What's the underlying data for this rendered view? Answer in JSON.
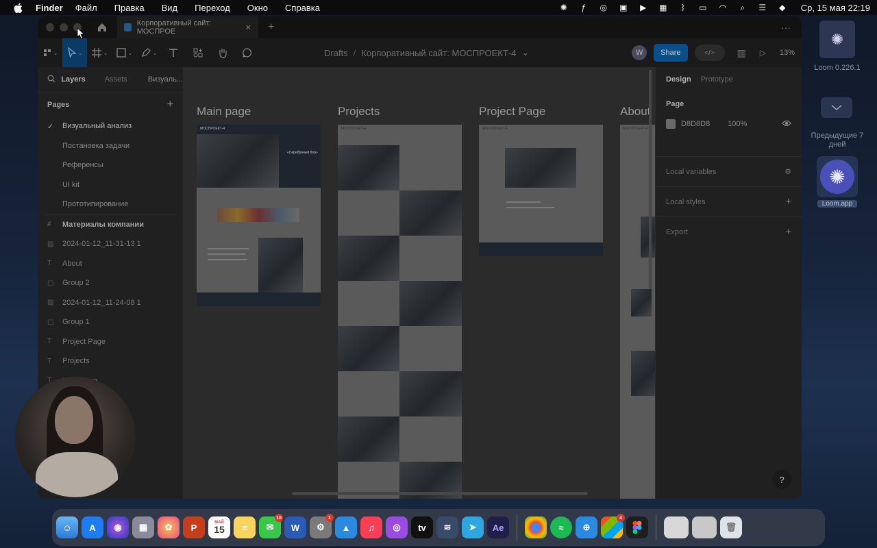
{
  "menubar": {
    "app": "Finder",
    "items": [
      "Файл",
      "Правка",
      "Вид",
      "Переход",
      "Окно",
      "Справка"
    ],
    "clock": "Ср, 15 мая  22:19"
  },
  "tabbar": {
    "tab_title": "Корпоративный сайт: МОСПРОЕ",
    "close": "✕",
    "add": "+",
    "more": "···"
  },
  "toolbar": {
    "breadcrumb_root": "Drafts",
    "breadcrumb_sep": "/",
    "file_name": "Корпоративный сайт: МОСПРОЕКТ-4",
    "file_caret": "⌄",
    "avatar_letter": "W",
    "share_label": "Share",
    "zoom": "13%"
  },
  "left_panel": {
    "tabs": [
      "Layers",
      "Assets",
      "Визуаль..."
    ],
    "pages_heading": "Pages",
    "add_page": "+",
    "pages": [
      {
        "label": "Визуальный анализ",
        "selected": true
      },
      {
        "label": "Постановка задачи"
      },
      {
        "label": "Референсы"
      },
      {
        "label": "UI kit"
      },
      {
        "label": "Прототипирование"
      }
    ],
    "layers": [
      {
        "label": "Материалы компании",
        "icon": "#",
        "strong": true
      },
      {
        "label": "2024-01-12_11-31-13 1",
        "icon": "▨"
      },
      {
        "label": "About",
        "icon": "T"
      },
      {
        "label": "Group 2",
        "icon": "▢"
      },
      {
        "label": "2024-01-12_11-24-08 1",
        "icon": "▨"
      },
      {
        "label": "Group 1",
        "icon": "▢"
      },
      {
        "label": "Project Page",
        "icon": "T"
      },
      {
        "label": "Projects",
        "icon": "T"
      },
      {
        "label": "Main page",
        "icon": "T"
      }
    ]
  },
  "canvas": {
    "frames": [
      {
        "label": "Main page",
        "logo": "МОСПРОЕКТ-4",
        "hero": "«Серебряный бор»"
      },
      {
        "label": "Projects",
        "logo": "МОСПРОЕКТ-4"
      },
      {
        "label": "Project Page",
        "logo": "МОСПРОЕКТ-4"
      },
      {
        "label": "About",
        "logo": "МОСПРОЕКТ-4"
      }
    ]
  },
  "right_panel": {
    "tabs": [
      "Design",
      "Prototype"
    ],
    "page_heading": "Page",
    "page_color": "D8D8D8",
    "page_opacity": "100%",
    "sections": [
      "Local variables",
      "Local styles",
      "Export"
    ],
    "help": "?"
  },
  "desktop": {
    "loom_label": "Loom 0.226.1",
    "previous_label": "Предыдущие 7 дней",
    "loom_app_label": "Loom.app"
  },
  "dock": {
    "calendar_month": "МАЙ",
    "calendar_day": "15",
    "apps": [
      "Finder",
      "App Store",
      "Siri",
      "Launchpad",
      "Photos",
      "PowerPoint",
      "Calendar",
      "Notes",
      "Messages",
      "Word",
      "System Settings",
      "Keynote",
      "Music",
      "Podcasts",
      "Apple TV",
      "Audio",
      "Telegram",
      "After Effects",
      "Chrome",
      "Spotify",
      "Safari",
      "Microsoft",
      "Figma",
      "Downloads",
      "Screenshot",
      "Trash"
    ],
    "badges": {
      "messages": "10",
      "settings": "1",
      "microsoft": "4"
    }
  },
  "colors": {
    "accent": "#0c8ce9",
    "share": "#0d99ff"
  }
}
